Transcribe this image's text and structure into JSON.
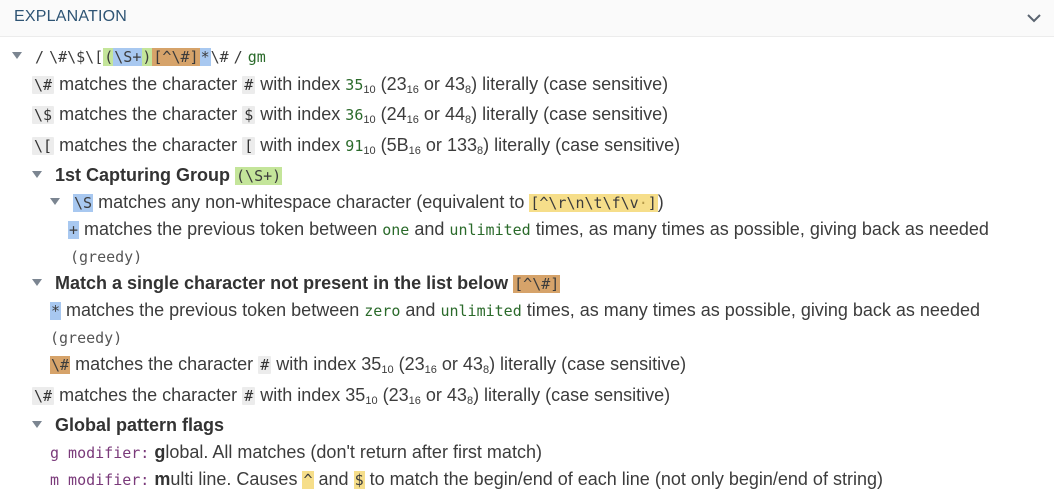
{
  "header": {
    "title": "EXPLANATION"
  },
  "regex": {
    "delim_open": "/",
    "part1": "\\#\\$\\[",
    "grp_open": "(",
    "grp_body": "\\S+",
    "grp_close": ")",
    "class": "[^\\#]",
    "star": "*",
    "tail": "\\#",
    "delim_close": "/",
    "flags": "gm"
  },
  "rows": {
    "r1": {
      "tok": "\\#",
      "a": "matches the character",
      "ch": "#",
      "b": "with index",
      "dec": "35",
      "b10": "10",
      "hex1": "(23",
      "b16": "16",
      "or": "or",
      "oct": "43",
      "b8": "8",
      "end": ") literally (case sensitive)"
    },
    "r2": {
      "tok": "\\$",
      "a": "matches the character",
      "ch": "$",
      "b": "with index",
      "dec": "36",
      "b10": "10",
      "hex1": "(24",
      "b16": "16",
      "or": "or",
      "oct": "44",
      "b8": "8",
      "end": ") literally (case sensitive)"
    },
    "r3": {
      "tok": "\\[",
      "a": "matches the character",
      "ch": "[",
      "b": "with index",
      "dec": "91",
      "b10": "10",
      "hex1": "(5B",
      "b16": "16",
      "or": "or",
      "oct": "133",
      "b8": "8",
      "end": ") literally (case sensitive)"
    },
    "g1": {
      "title": "1st Capturing Group",
      "tok": "(\\S+)"
    },
    "s": {
      "tok": "\\S",
      "text": "matches any non-whitespace character (equivalent to",
      "cls": "[^\\r\\n\\t\\f\\v",
      "dot": "·",
      "cls_end": "]",
      "close": ")"
    },
    "plus": {
      "tok": "+",
      "a": "matches the previous token between",
      "one": "one",
      "and": "and",
      "unl": "unlimited",
      "b": "times, as many times as possible, giving back as needed",
      "greedy": "(greedy)"
    },
    "m": {
      "title": "Match a single character not present in the list below",
      "tok": "[^\\#]"
    },
    "star": {
      "tok": "*",
      "a": "matches the previous token between",
      "zero": "zero",
      "and": "and",
      "unl": "unlimited",
      "b": "times, as many times as possible, giving back as needed",
      "greedy": "(greedy)"
    },
    "r4": {
      "tok": "\\#",
      "a": "matches the character",
      "ch": "#",
      "b": "with index",
      "dec": "35",
      "b10": "10",
      "hex1": "(23",
      "b16": "16",
      "or": "or",
      "oct": "43",
      "b8": "8",
      "end": ") literally (case sensitive)"
    },
    "r5": {
      "tok": "\\#",
      "a": "matches the character",
      "ch": "#",
      "b": "with index",
      "dec": "35",
      "b10": "10",
      "hex1": "(23",
      "b16": "16",
      "or": "or",
      "oct": "43",
      "b8": "8",
      "end": ") literally (case sensitive)"
    },
    "flags": {
      "title": "Global pattern flags"
    },
    "fg": {
      "mod": "g modifier:",
      "letter": "g",
      "text": "lobal. All matches (don't return after first match)"
    },
    "fm": {
      "mod": "m modifier:",
      "letter": "m",
      "text1": "ulti line. Causes",
      "caret": "^",
      "and": "and",
      "dollar": "$",
      "text2": "to match the begin/end of each line (not only begin/end of string)"
    }
  }
}
